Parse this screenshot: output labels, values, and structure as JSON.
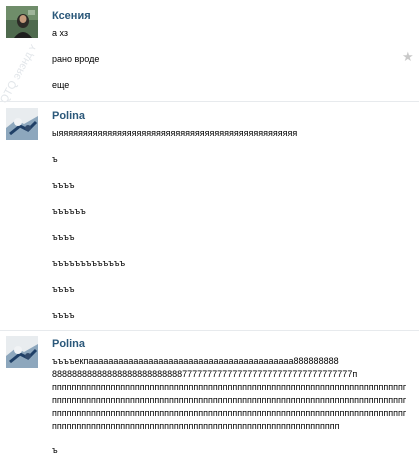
{
  "messages": [
    {
      "author": "Ксения",
      "lines": [
        "а хз",
        "рано вроде",
        "еще"
      ]
    },
    {
      "author": "Polina",
      "lines": [
        "ыяяяяяяяяяяяяяяяяяяяяяяяяяяяяяяяяяяяяяяяяяяяяяяяяя",
        "ъ",
        "ъъъъ",
        "ъъъъъъ",
        "ъъъъ",
        "ъъъъъъъъъъъъъ",
        "ъъъъ",
        "ъъъъ"
      ]
    },
    {
      "author": "Polina",
      "lines": [
        "ъъъъекпааааааааааааааааааааааааааааааааааааааааа888888888",
        "888888888888888888888888887777777777777777777777777777777777п",
        "пппппппппппппппппппппппппппппппппппппппппппппппппппппппппппппппппппппппппппп",
        "пппппппппппппппппппппппппппппппппппппппппппппппппппппппппппппппппппппппппппп",
        "пппппппппппппппппппппппппппппппппппппппппппппппппппппппппппппппппппппппппппп",
        "ппппппппппппппппппппппппппппппппппппппппппппппппппппппппппп",
        "ъ"
      ]
    }
  ],
  "colors": {
    "author": "#2b587a",
    "star": "#c9c9c9",
    "divider": "#e7eaed"
  },
  "icons": {
    "favorite": "star-icon"
  }
}
